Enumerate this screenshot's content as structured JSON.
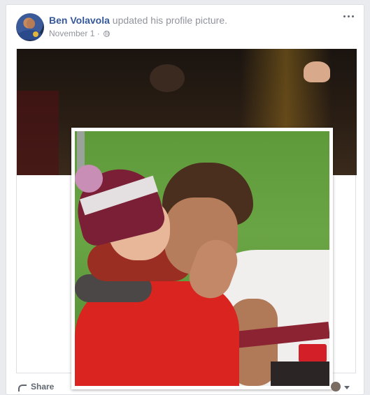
{
  "post": {
    "author": "Ben Volavola",
    "action_text": " updated his profile picture.",
    "date": "November 1",
    "separator": " · "
  },
  "actions": {
    "share_label": "Share"
  },
  "icons": {
    "more": "more-options-icon",
    "privacy": "globe-icon",
    "share": "share-icon",
    "audience": "audience-selector-icon"
  },
  "colors": {
    "author_link": "#365899",
    "meta_text": "#90949c",
    "background": "#e9ebee"
  }
}
